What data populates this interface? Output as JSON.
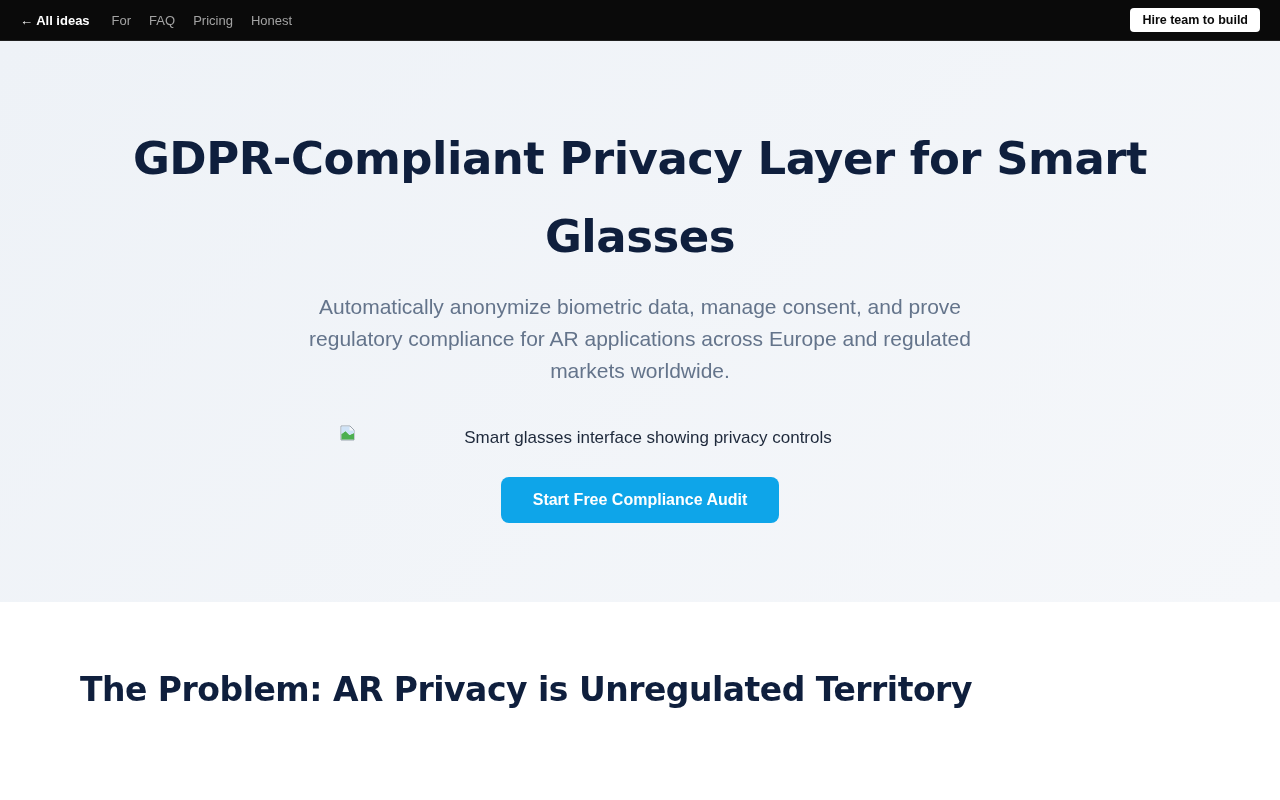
{
  "nav": {
    "back_link": "← All ideas",
    "links": [
      "For",
      "FAQ",
      "Pricing",
      "Honest"
    ],
    "cta": "Hire team to build"
  },
  "hero": {
    "title": "GDPR-Compliant Privacy Layer for Smart Glasses",
    "subtitle": "Automatically anonymize biometric data, manage consent, and prove regulatory compliance for AR applications across Europe and regulated markets worldwide.",
    "image": {
      "alt": "Smart glasses interface showing privacy controls"
    },
    "cta": "Start Free Compliance Audit"
  },
  "problem": {
    "heading": "The Problem: AR Privacy is Unregulated Territory"
  }
}
